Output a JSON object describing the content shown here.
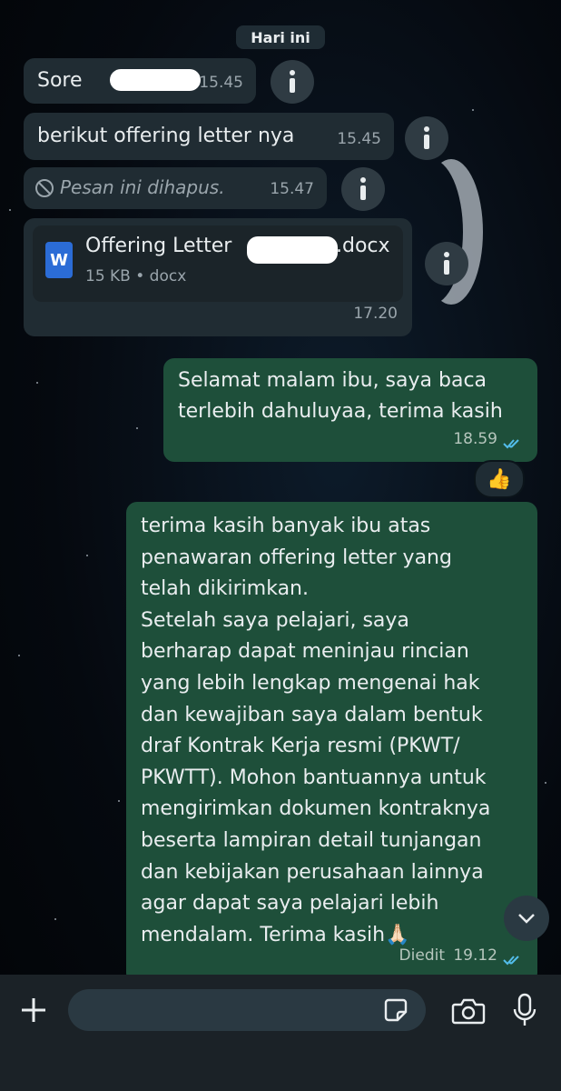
{
  "header": {
    "date_chip": "Hari ini"
  },
  "messages": [
    {
      "direction": "incoming",
      "text": "Sore",
      "time": "15.45"
    },
    {
      "direction": "incoming",
      "text": "berikut offering letter nya",
      "time": "15.45"
    },
    {
      "direction": "incoming",
      "text": "Pesan ini dihapus.",
      "time": "15.47",
      "deleted": true
    },
    {
      "direction": "incoming",
      "file": {
        "name_prefix": "Offering Letter",
        "name_suffix": ".docx",
        "meta": "15 KB • docx",
        "icon_letter": "W"
      },
      "time": "17.20"
    },
    {
      "direction": "outgoing",
      "lines": [
        "Selamat malam ibu, saya baca",
        "terlebih dahuluyaa, terima kasih"
      ],
      "time": "18.59",
      "status": "read",
      "reaction": "👍"
    },
    {
      "direction": "outgoing",
      "lines": [
        "terima kasih banyak ibu atas",
        "penawaran offering letter yang",
        "telah dikirimkan.",
        "Setelah saya pelajari, saya",
        "berharap dapat meninjau rincian",
        "yang lebih lengkap mengenai hak",
        "dan kewajiban saya dalam bentuk",
        "draf Kontrak Kerja resmi (PKWT/",
        "PKWTT). Mohon bantuannya untuk",
        "mengirimkan dokumen kontraknya",
        "beserta lampiran detail tunjangan",
        "dan kebijakan perusahaan lainnya",
        "agar dapat saya pelajari lebih",
        "mendalam. Terima kasih🙏🏻"
      ],
      "edited_label": "Diedit",
      "time": "19.12",
      "status": "read"
    }
  ],
  "composer": {
    "value": "",
    "placeholder": ""
  },
  "icons": {
    "info": "info-icon",
    "deleted": "blocked-icon",
    "read_receipt": "double-check-icon",
    "scroll_down": "chevron-down-icon",
    "attach": "plus-icon",
    "sticker": "sticker-icon",
    "camera": "camera-icon",
    "mic": "microphone-icon"
  },
  "colors": {
    "incoming_bubble": "#202c33",
    "outgoing_bubble": "#1e4f3a",
    "read_tick": "#53bdeb",
    "doc_icon": "#2b6cd6"
  }
}
